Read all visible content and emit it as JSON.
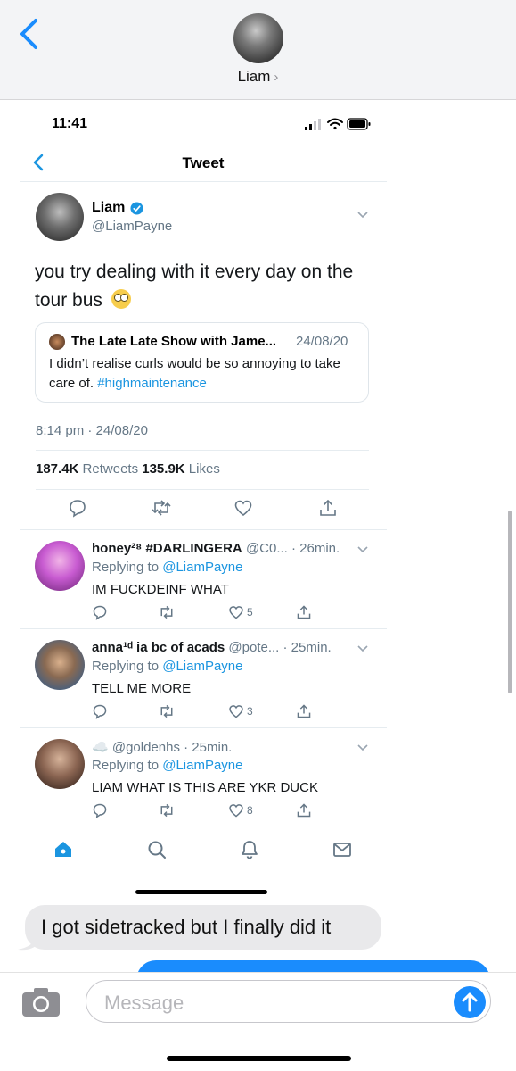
{
  "messages_header": {
    "contact_name": "Liam",
    "chevron": "›"
  },
  "screenshot": {
    "status_time": "11:41",
    "nav_title": "Tweet",
    "tweet": {
      "name": "Liam",
      "handle": "@LiamPayne",
      "text": "you try dealing with it every day on the tour bus",
      "quote": {
        "name": "The Late Late Show with Jame...",
        "date": "24/08/20",
        "text": "I didn’t realise curls would be so annoying to take care of.",
        "hashtag": "#highmaintenance"
      },
      "timestamp": "8:14 pm · 24/08/20",
      "retweets_count": "187.4K",
      "retweets_label": "Retweets",
      "likes_count": "135.9K",
      "likes_label": "Likes"
    },
    "replies": [
      {
        "name": "honey²⁸ #DARLINGERA",
        "handle_time": "@C0... · 26min.",
        "replying_prefix": "Replying to",
        "replying_to": "@LiamPayne",
        "text": "IM FUCKDEINF WHAT",
        "likes": "5",
        "avatar_color": "#c85bd1"
      },
      {
        "name": "anna¹ᵈ ia bc of acads",
        "handle_time": "@pote... · 25min.",
        "replying_prefix": "Replying to",
        "replying_to": "@LiamPayne",
        "text": "TELL ME MORE",
        "likes": "3",
        "avatar_color": "#3a5d86"
      },
      {
        "name": "☁️",
        "handle_time": "@goldenhs · 25min.",
        "replying_prefix": "Replying to",
        "replying_to": "@LiamPayne",
        "text": "LIAM WHAT IS THIS ARE YKR DUCK",
        "likes": "8",
        "avatar_color": "#6a4a3a"
      }
    ],
    "tabs": [
      "home-icon",
      "search-icon",
      "bell-icon",
      "mail-icon"
    ]
  },
  "conversation": {
    "incoming_message": "I got sidetracked but I finally did it"
  },
  "input": {
    "placeholder": "Message"
  },
  "colors": {
    "ios_blue": "#1a8cfd",
    "twitter_blue": "#1b95e0",
    "gray_text": "#657786"
  }
}
